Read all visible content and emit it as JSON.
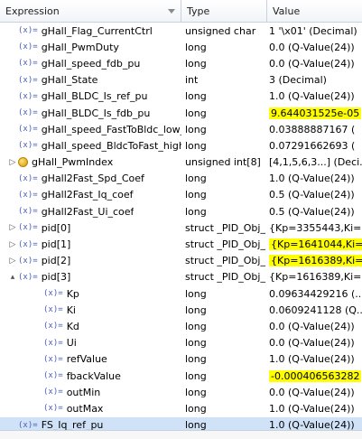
{
  "header": {
    "expression": "Expression",
    "type": "Type",
    "value": "Value"
  },
  "rows": [
    {
      "expr": "gHall_Flag_CurrentCtrl",
      "type": "unsigned char",
      "value": "1 '\\x01' (Decimal)",
      "level": 0,
      "icon": "variable",
      "twisty": "none"
    },
    {
      "expr": "gHall_PwmDuty",
      "type": "long",
      "value": "0.0 (Q-Value(24))",
      "level": 0,
      "icon": "variable",
      "twisty": "none"
    },
    {
      "expr": "gHall_speed_fdb_pu",
      "type": "long",
      "value": "0.0 (Q-Value(24))",
      "level": 0,
      "icon": "variable",
      "twisty": "none"
    },
    {
      "expr": "gHall_State",
      "type": "int",
      "value": "3 (Decimal)",
      "level": 0,
      "icon": "variable",
      "twisty": "none"
    },
    {
      "expr": "gHall_BLDC_Is_ref_pu",
      "type": "long",
      "value": "1.0 (Q-Value(24))",
      "level": 0,
      "icon": "variable",
      "twisty": "none"
    },
    {
      "expr": "gHall_BLDC_Is_fdb_pu",
      "type": "long",
      "value": "9.644031525e-05",
      "level": 0,
      "icon": "variable",
      "twisty": "none",
      "highlight": true
    },
    {
      "expr": "gHall_speed_FastToBldc_low_p",
      "type": "long",
      "value": "0.03888887167 (",
      "level": 0,
      "icon": "variable",
      "twisty": "none"
    },
    {
      "expr": "gHall_speed_BldcToFast_high_",
      "type": "long",
      "value": "0.07291662693 (",
      "level": 0,
      "icon": "variable",
      "twisty": "none"
    },
    {
      "expr": "gHall_PwmIndex",
      "type": "unsigned int[8]",
      "value": "[4,1,5,6,3...] (Deci...",
      "level": 0,
      "icon": "struct",
      "twisty": "collapsed"
    },
    {
      "expr": "gHall2Fast_Spd_Coef",
      "type": "long",
      "value": "1.0 (Q-Value(24))",
      "level": 0,
      "icon": "variable",
      "twisty": "none"
    },
    {
      "expr": "gHall2Fast_Iq_coef",
      "type": "long",
      "value": "0.5 (Q-Value(24))",
      "level": 0,
      "icon": "variable",
      "twisty": "none"
    },
    {
      "expr": "gHall2Fast_Ui_coef",
      "type": "long",
      "value": "0.5 (Q-Value(24))",
      "level": 0,
      "icon": "variable",
      "twisty": "none"
    },
    {
      "expr": "pid[0]",
      "type": "struct _PID_Obj_",
      "value": "{Kp=3355443,Ki=...",
      "level": 0,
      "icon": "variable",
      "twisty": "collapsed"
    },
    {
      "expr": "pid[1]",
      "type": "struct _PID_Obj_",
      "value": "{Kp=1641044,Ki=...",
      "level": 0,
      "icon": "variable",
      "twisty": "collapsed",
      "highlight": true
    },
    {
      "expr": "pid[2]",
      "type": "struct _PID_Obj_",
      "value": "{Kp=1616389,Ki=...",
      "level": 0,
      "icon": "variable",
      "twisty": "collapsed",
      "highlight": true
    },
    {
      "expr": "pid[3]",
      "type": "struct _PID_Obj_",
      "value": "{Kp=1616389,Ki=...",
      "level": 0,
      "icon": "variable",
      "twisty": "expanded"
    },
    {
      "expr": "Kp",
      "type": "long",
      "value": "0.09634429216 (...",
      "level": 1,
      "icon": "variable",
      "twisty": "none"
    },
    {
      "expr": "Ki",
      "type": "long",
      "value": "0.0609241128 (Q...",
      "level": 1,
      "icon": "variable",
      "twisty": "none"
    },
    {
      "expr": "Kd",
      "type": "long",
      "value": "0.0 (Q-Value(24))",
      "level": 1,
      "icon": "variable",
      "twisty": "none"
    },
    {
      "expr": "Ui",
      "type": "long",
      "value": "0.0 (Q-Value(24))",
      "level": 1,
      "icon": "variable",
      "twisty": "none"
    },
    {
      "expr": "refValue",
      "type": "long",
      "value": "1.0 (Q-Value(24))",
      "level": 1,
      "icon": "variable",
      "twisty": "none"
    },
    {
      "expr": "fbackValue",
      "type": "long",
      "value": "-0.000406563282",
      "level": 1,
      "icon": "variable",
      "twisty": "none",
      "highlight": true
    },
    {
      "expr": "outMin",
      "type": "long",
      "value": "0.0 (Q-Value(24))",
      "level": 1,
      "icon": "variable",
      "twisty": "none"
    },
    {
      "expr": "outMax",
      "type": "long",
      "value": "1.0 (Q-Value(24))",
      "level": 1,
      "icon": "variable",
      "twisty": "none"
    },
    {
      "expr": "FS_Iq_ref_pu",
      "type": "long",
      "value": "1.0 (Q-Value(24))",
      "level": 0,
      "icon": "variable",
      "twisty": "none",
      "selected": true
    }
  ],
  "glyphs": {
    "variable": "(x)=",
    "expanded": "▴",
    "collapsed": "▷"
  }
}
